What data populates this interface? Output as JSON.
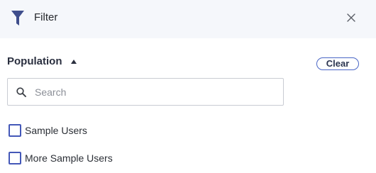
{
  "header": {
    "title": "Filter",
    "filter_icon": "filter-funnel-icon",
    "close_icon": "close-icon",
    "icon_color": "#3f4e8c"
  },
  "section": {
    "title": "Population",
    "caret_icon": "caret-up-icon",
    "clear_label": "Clear"
  },
  "search": {
    "placeholder": "Search",
    "value": "",
    "icon": "search-icon"
  },
  "options": [
    {
      "label": "Sample Users",
      "checked": false
    },
    {
      "label": "More Sample Users",
      "checked": false
    }
  ],
  "colors": {
    "accent": "#4458b8",
    "header_background": "#f5f7fb",
    "text": "#2b2f36"
  }
}
